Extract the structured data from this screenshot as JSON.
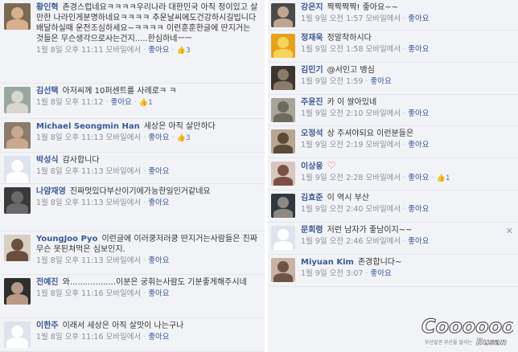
{
  "left": [
    {
      "name": "황인혁",
      "text": "존경스럽네요ㅋㅋㅋㅋ우리나라 대한민국 아직 정이있고 살만한 나라인게분명하네요ㅋㅋㅋㅋ 추운날씨에도건강하시길빕니다 배달하실때 운전조심하세요~ㅋㅋㅋㅋ 이런훈훈한글에 딴지거는 것들은 무슨생각으로사는건지.....한심하네ㅡㅡ",
      "time": "1월 8일 오후 11:11 모바일에서",
      "like": "좋아요",
      "likes": "3",
      "avatar_bg": "#7b6a52",
      "avatar_fg": "#d7b08f"
    },
    {
      "name": "김선택",
      "text": "아저씨께 10퍼센트를 사례로ㅋ ㅋ",
      "time": "1월 8일 오후 11:12 ",
      "like": "좋아요",
      "likes": "1",
      "avatar_bg": "#9aa7a0",
      "avatar_fg": "#d8d6cf"
    },
    {
      "name": "Michael Seongmin Han",
      "text": "세상은 아직 살만하다",
      "time": "1월 8일 오후 11:13 모바일에서",
      "like": "좋아요",
      "likes": "3",
      "avatar_bg": "#8b7b6c",
      "avatar_fg": "#c9a98d"
    },
    {
      "name": "박성식",
      "text": "감사합니다",
      "time": "1월 8일 오후 11:13 모바일에서",
      "like": "좋아요",
      "likes": "",
      "avatar_bg": "#dfe3ee",
      "avatar_fg": "#ffffff"
    },
    {
      "name": "나얌재영",
      "text": "진짜멋있다부산이기에가능한일인거같네요",
      "time": "1월 8일 오후 11:13 모바일에서",
      "like": "좋아요",
      "likes": "",
      "avatar_bg": "#3a3a3a",
      "avatar_fg": "#6a6a6a"
    },
    {
      "name": "YoungJoo Pyo",
      "text": "이런글에 이러쿵저러쿵 딴지거는사람들은 진짜 무슨 못된쳐먹은 심보인지.",
      "time": "1월 8일 오후 11:13 모바일에서",
      "like": "좋아요",
      "likes": "",
      "avatar_bg": "#d9cfc5",
      "avatar_fg": "#6b4f3c"
    },
    {
      "name": "전예진",
      "text": "와..................이분은 궁휘는사람도 기분좋게해주시네",
      "time": "1월 8일 오후 11:16 모바일에서",
      "like": "좋아요",
      "likes": "",
      "avatar_bg": "#2e2e2e",
      "avatar_fg": "#b79a86"
    },
    {
      "name": "이한주",
      "text": "이래서 세상은 아직 살맛이 나는구나",
      "time": "1월 8일 오후 11:16 모바일에서",
      "like": "좋아요",
      "likes": "",
      "avatar_bg": "#dfe3ee",
      "avatar_fg": "#ffffff"
    }
  ],
  "right": [
    {
      "name": "강은지",
      "text": "짝짝짝짝! 좋아요~~",
      "time": "1월 9일 오전 1:57 모바일에서",
      "like": "좋아요",
      "likes": "",
      "avatar_bg": "#4a4a4a",
      "avatar_fg": "#bfa592"
    },
    {
      "name": "정재욱",
      "text": "정말착하시다",
      "time": "1월 9일 오전 1:58 모바일에서",
      "like": "좋아요",
      "likes": "",
      "avatar_bg": "#e6a21c",
      "avatar_fg": "#f6d35a"
    },
    {
      "name": "김민기",
      "text": "@서인고 뱅심",
      "time": "1월 9일 오전 1:59",
      "like": "좋아요",
      "likes": "",
      "avatar_bg": "#3c3530",
      "avatar_fg": "#8c7a6a"
    },
    {
      "name": "주윤진",
      "text": "카 이 쌀아있네",
      "time": "1월 9일 오전 2:10 모바일에서",
      "like": "좋아요",
      "likes": "",
      "avatar_bg": "#a7a49a",
      "avatar_fg": "#6f6a5e"
    },
    {
      "name": "오정석",
      "text": "상 주셔야되요 이런분들은",
      "time": "1월 9일 오전 2:19 모바일에서",
      "like": "좋아요",
      "likes": "",
      "avatar_bg": "#b7a690",
      "avatar_fg": "#5b4a3a"
    },
    {
      "name": "이상웅",
      "text": "",
      "time": "1월 9일 오전 2:28 모바일에서",
      "like": "좋아요",
      "likes": "1",
      "avatar_bg": "#d8c7bf",
      "avatar_fg": "#7a5245"
    },
    {
      "name": "김효준",
      "text": "이 역시 부산",
      "time": "1월 9일 오전 2:40 모바일에서",
      "like": "좋아요",
      "likes": "",
      "avatar_bg": "#2f3a3f",
      "avatar_fg": "#8e8a83"
    },
    {
      "name": "문회령",
      "text": "저런 남자가 좋남이지~~",
      "time": "1월 9일 오전 2:46 모바일에서",
      "like": "좋아요",
      "likes": "",
      "avatar_bg": "#dfe3ee",
      "avatar_fg": "#ffffff"
    },
    {
      "name": "Miyuan Kim",
      "text": "존경합니다~",
      "time": "1월 9일 오전 3:07",
      "like": "좋아요",
      "likes": "",
      "avatar_bg": "#c7b3a5",
      "avatar_fg": "#6e5447"
    }
  ],
  "close_glyph": "✕",
  "heart_glyph": "♡",
  "thumb_glyph": "👍",
  "separator": "·",
  "watermark": {
    "main": "Cooooool!",
    "sub": "부산발견 부산을 알리는",
    "brand": "Busan"
  }
}
